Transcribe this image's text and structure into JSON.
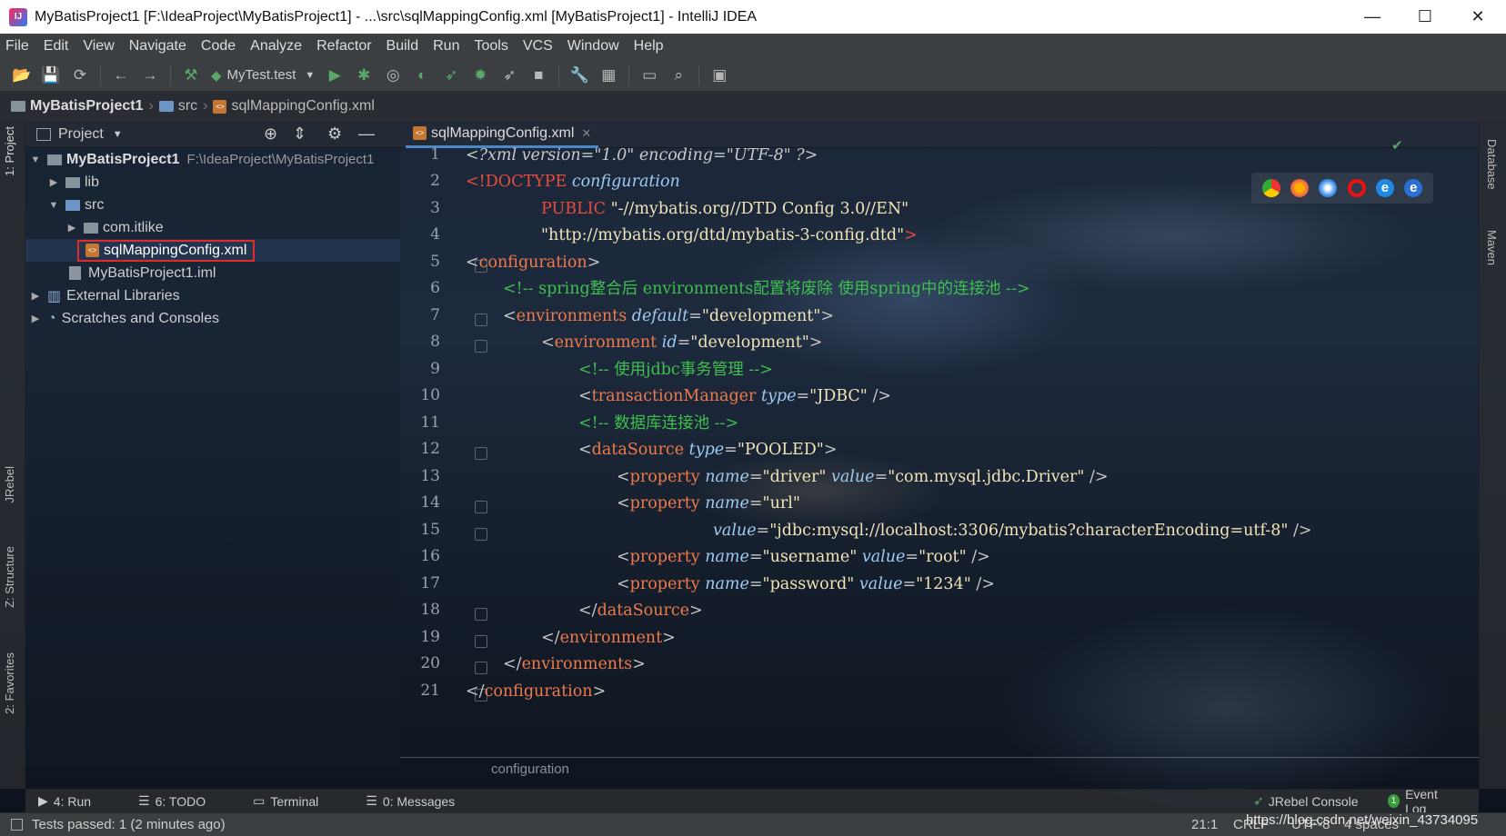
{
  "window": {
    "title": "MyBatisProject1 [F:\\IdeaProject\\MyBatisProject1] - ...\\src\\sqlMappingConfig.xml [MyBatisProject1] - IntelliJ IDEA"
  },
  "menu": [
    "File",
    "Edit",
    "View",
    "Navigate",
    "Code",
    "Analyze",
    "Refactor",
    "Build",
    "Run",
    "Tools",
    "VCS",
    "Window",
    "Help"
  ],
  "toolbar": {
    "run_config": "MyTest.test"
  },
  "breadcrumb": [
    "MyBatisProject1",
    "src",
    "sqlMappingConfig.xml"
  ],
  "project": {
    "header": "Project",
    "tree": [
      {
        "label": "MyBatisProject1",
        "path": "F:\\IdeaProject\\MyBatisProject1"
      },
      {
        "label": "lib"
      },
      {
        "label": "src"
      },
      {
        "label": "com.itlike"
      },
      {
        "label": "sqlMappingConfig.xml"
      },
      {
        "label": "MyBatisProject1.iml"
      },
      {
        "label": "External Libraries"
      },
      {
        "label": "Scratches and Consoles"
      }
    ]
  },
  "side_tabs": {
    "left": [
      "1: Project",
      "JRebel",
      "Z: Structure",
      "2: Favorites"
    ],
    "right": [
      "Database",
      "Maven"
    ]
  },
  "editor": {
    "tab": "sqlMappingConfig.xml",
    "line_numbers": [
      "1",
      "2",
      "3",
      "4",
      "5",
      "6",
      "7",
      "8",
      "9",
      "10",
      "11",
      "12",
      "13",
      "14",
      "15",
      "16",
      "17",
      "18",
      "19",
      "20",
      "21"
    ],
    "breadcrumb": "configuration",
    "code": {
      "l1_decl": "<?xml version=\"1.0\" encoding=\"UTF-8\" ?>",
      "l2_doctype": "<!DOCTYPE",
      "l2_name": "configuration",
      "l3_public": "PUBLIC",
      "l3_id": "\"-//mybatis.org//DTD Config 3.0//EN\"",
      "l4_url": "\"http://mybatis.org/dtd/mybatis-3-config.dtd\"",
      "l6_comment": "<!-- spring整合后 environments配置将废除 使用spring中的连接池 -->",
      "l9_comment": "<!-- 使用jdbc事务管理 -->",
      "l11_comment": "<!-- 数据库连接池 -->",
      "configuration": "configuration",
      "environments": "environments",
      "environment": "environment",
      "transactionManager": "transactionManager",
      "dataSource": "dataSource",
      "property": "property",
      "attr_default": "default",
      "attr_id": "id",
      "attr_type": "type",
      "attr_name": "name",
      "attr_value": "value",
      "v_development": "\"development\"",
      "v_jdbc": "\"JDBC\"",
      "v_pooled": "\"POOLED\"",
      "v_driver": "\"driver\"",
      "v_driver_class": "\"com.mysql.jdbc.Driver\"",
      "v_url": "\"url\"",
      "v_url_val": "\"jdbc:mysql://localhost:3306/mybatis?characterEncoding=utf-8\"",
      "v_username": "\"username\"",
      "v_root": "\"root\"",
      "v_password": "\"password\"",
      "v_1234": "\"1234\""
    }
  },
  "bottom_tabs": [
    "4: Run",
    "6: TODO",
    "Terminal",
    "0: Messages",
    "JRebel Console",
    "Event Log"
  ],
  "status": {
    "message": "Tests passed: 1 (2 minutes ago)",
    "position": "21:1",
    "line_sep": "CRLF",
    "encoding": "UTF-8",
    "indent": "4 spaces",
    "watermark": "https://blog.csdn.net/weixin_43734095"
  },
  "colors": {
    "tag": "#ef7a4c",
    "attr": "#9ecbf2",
    "string": "#f0e4b8",
    "comment": "#3fbf4f",
    "selection_outline": "#e32b2b"
  }
}
